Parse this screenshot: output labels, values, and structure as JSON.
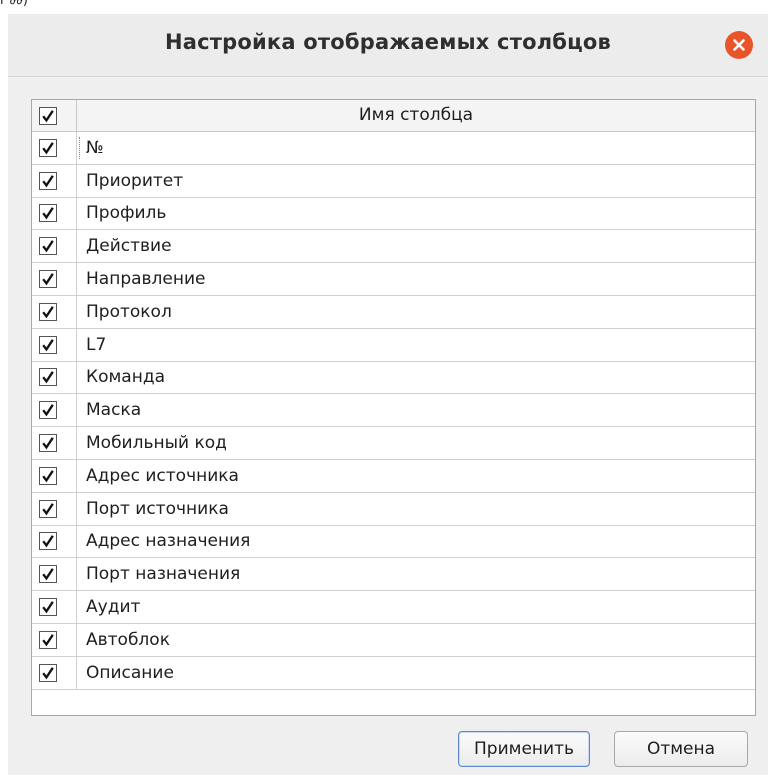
{
  "window": {
    "title": "Настройка отображаемых столбцов",
    "top_fragment": "r ∂∂)"
  },
  "table": {
    "header": {
      "name_column": "Имя столбца",
      "all_checked": true
    },
    "rows": [
      {
        "label": "№",
        "checked": true
      },
      {
        "label": "Приоритет",
        "checked": true
      },
      {
        "label": "Профиль",
        "checked": true
      },
      {
        "label": "Действие",
        "checked": true
      },
      {
        "label": "Направление",
        "checked": true
      },
      {
        "label": "Протокол",
        "checked": true
      },
      {
        "label": "L7",
        "checked": true
      },
      {
        "label": "Команда",
        "checked": true
      },
      {
        "label": "Маска",
        "checked": true
      },
      {
        "label": "Мобильный код",
        "checked": true
      },
      {
        "label": "Адрес источника",
        "checked": true
      },
      {
        "label": "Порт источника",
        "checked": true
      },
      {
        "label": "Адрес назначения",
        "checked": true
      },
      {
        "label": "Порт назначения",
        "checked": true
      },
      {
        "label": "Аудит",
        "checked": true
      },
      {
        "label": "Автоблок",
        "checked": true
      },
      {
        "label": "Описание",
        "checked": true
      }
    ]
  },
  "buttons": {
    "apply": "Применить",
    "cancel": "Отмена"
  },
  "colors": {
    "close_button": "#e9542a",
    "accent_border": "#5d87c9",
    "dialog_bg": "#efefef"
  },
  "icons": {
    "close": "close-icon",
    "check": "checkmark-icon"
  }
}
